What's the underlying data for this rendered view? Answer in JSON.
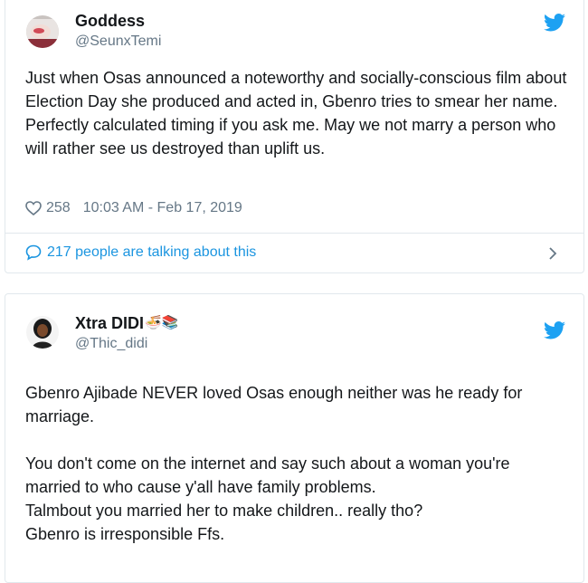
{
  "tweets": [
    {
      "name": "Goddess",
      "handle": "@SeunxTemi",
      "body": [
        "Just when Osas announced a noteworthy and socially-conscious film about Election Day she produced and acted in, Gbenro tries to smear her name.",
        "Perfectly calculated timing if you ask me. May we not marry a person who will rather see us destroyed than uplift us."
      ],
      "likes": "258",
      "timestamp": "10:03 AM - Feb 17, 2019",
      "talking": "217 people are talking about this"
    },
    {
      "name": "Xtra DIDI",
      "name_emoji": "🍜📚",
      "handle": "@Thic_didi",
      "body": [
        "Gbenro Ajibade NEVER loved Osas enough neither was he ready for marriage.",
        "",
        "You don't come on the internet and say such about a woman you're married to who cause y'all have family problems.",
        "Talmbout you married her to make children.. really tho?",
        "Gbenro is irresponsible Ffs."
      ]
    }
  ],
  "colors": {
    "twitter_blue": "#1da1f2",
    "link_blue": "#1b95e0",
    "secondary_text": "#657786",
    "border": "#e1e8ed"
  },
  "icons": [
    "avatar",
    "twitter-bird-icon",
    "heart-icon",
    "speech-bubble-icon",
    "chevron-right-icon"
  ]
}
